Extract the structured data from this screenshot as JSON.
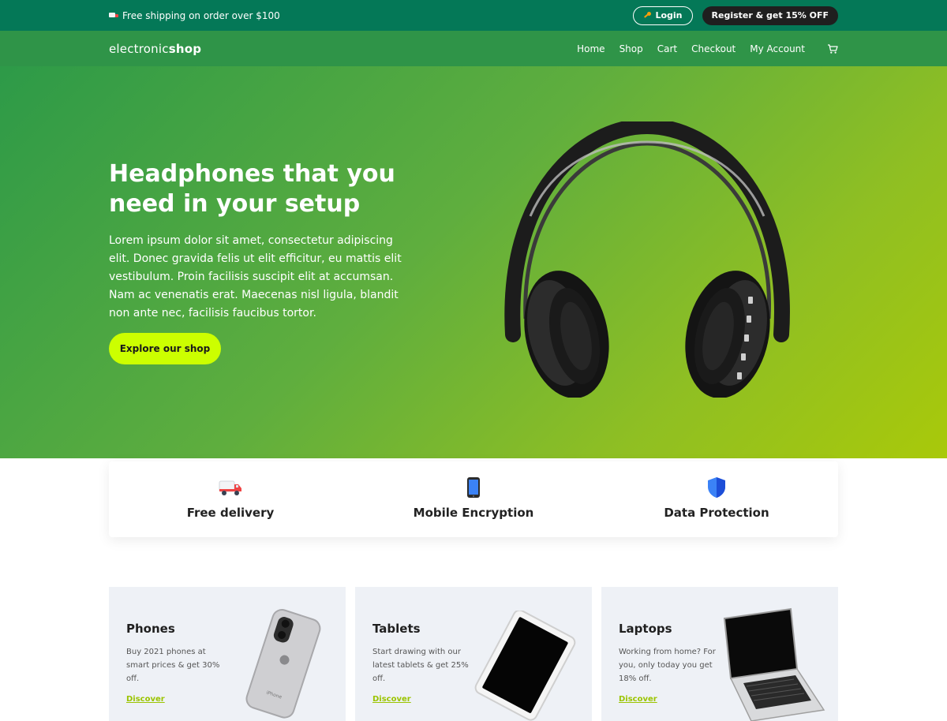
{
  "topbar": {
    "promo": "Free shipping on order over $100",
    "login_label": "Login",
    "register_label": "Register & get 15% OFF"
  },
  "nav": {
    "logo_light": "electronic",
    "logo_bold": "shop",
    "links": [
      "Home",
      "Shop",
      "Cart",
      "Checkout",
      "My Account"
    ]
  },
  "hero": {
    "title": "Headphones that you need in your setup",
    "description": "Lorem ipsum dolor sit amet, consectetur adipiscing elit. Donec gravida felis ut elit efficitur, eu mattis elit vestibulum. Proin facilisis suscipit elit at accumsan. Nam ac venenatis erat. Maecenas nisl ligula, blandit non ante nec, facilisis faucibus tortor.",
    "button_label": "Explore our shop"
  },
  "features": [
    {
      "label": "Free delivery",
      "icon": "delivery-truck-icon"
    },
    {
      "label": "Mobile Encryption",
      "icon": "mobile-phone-icon"
    },
    {
      "label": "Data Protection",
      "icon": "shield-icon"
    }
  ],
  "categories": [
    {
      "title": "Phones",
      "description": "Buy 2021 phones at smart prices & get 30% off.",
      "link": "Discover"
    },
    {
      "title": "Tablets",
      "description": "Start drawing with our latest tablets & get 25% off.",
      "link": "Discover"
    },
    {
      "title": "Laptops",
      "description": "Working from home? For you, only today you get 18% off.",
      "link": "Discover"
    }
  ],
  "colors": {
    "topbar_bg": "#047857",
    "nav_bg": "#2f9448",
    "accent": "#ccff00",
    "link": "#9bc400"
  }
}
